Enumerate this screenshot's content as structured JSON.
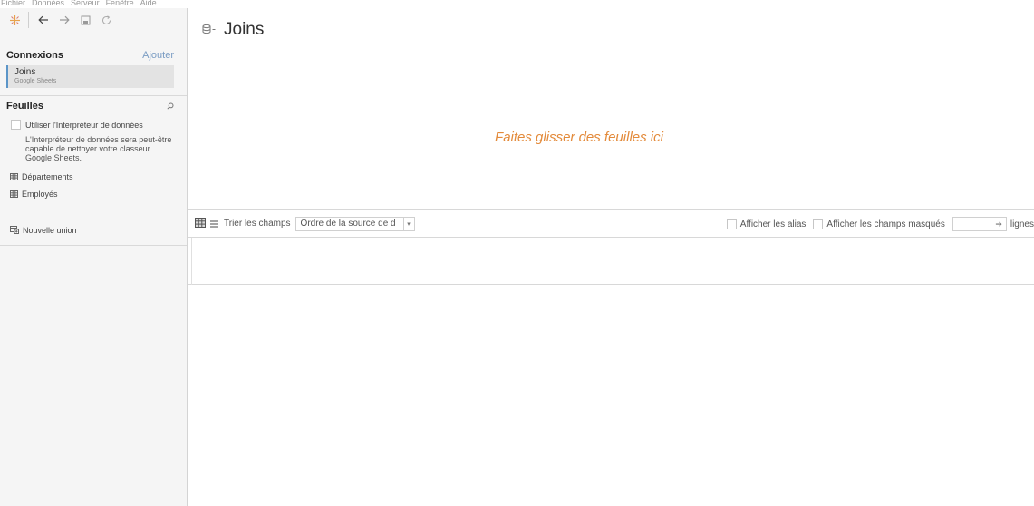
{
  "menu": [
    "Fichier",
    "Données",
    "Serveur",
    "Fenêtre",
    "Aide"
  ],
  "toolbar": {
    "icons": [
      "tableau-logo-icon",
      "back-arrow-icon",
      "forward-arrow-icon",
      "save-icon",
      "refresh-icon"
    ]
  },
  "connections": {
    "title": "Connexions",
    "add_label": "Ajouter",
    "items": [
      {
        "name": "Joins",
        "type": "Google Sheets"
      }
    ]
  },
  "sheets": {
    "title": "Feuilles",
    "interpreter_label": "Utiliser l'Interpréteur de données",
    "interpreter_desc": "L'Interpréteur de données sera peut-être capable de nettoyer votre classeur Google Sheets.",
    "items": [
      {
        "label": "Départements"
      },
      {
        "label": "Employés"
      }
    ],
    "new_union_label": "Nouvelle union"
  },
  "datasource": {
    "title": "Joins",
    "drop_hint": "Faites glisser des feuilles ici"
  },
  "grid_toolbar": {
    "sort_label": "Trier les champs",
    "sort_value": "Ordre de la source de d",
    "show_alias": "Afficher les alias",
    "show_hidden": "Afficher les champs masqués",
    "rows_label": "lignes"
  },
  "colors": {
    "accent_blue": "#5b95c8",
    "drop_hint_orange": "#e38a3a",
    "sidebar_bg": "#f5f5f5"
  }
}
